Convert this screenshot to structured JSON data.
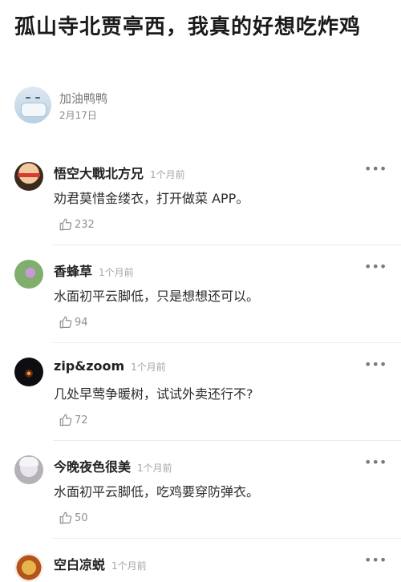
{
  "article": {
    "title": "孤山寺北贾亭西，我真的好想吃炸鸡",
    "author_name": "加油鸭鸭",
    "date": "2月17日"
  },
  "icons": {
    "more": "more-dots-icon",
    "like": "thumbs-up-icon"
  },
  "colors": {
    "text_primary": "#222222",
    "text_muted": "#a6a6a6",
    "divider": "#ececec"
  },
  "comments": [
    {
      "name": "悟空大戰北方兄",
      "time": "1个月前",
      "text": "劝君莫惜金缕衣，打开做菜 APP。",
      "likes": "232"
    },
    {
      "name": "香蜂草",
      "time": "1个月前",
      "text": "水面初平云脚低，只是想想还可以。",
      "likes": "94"
    },
    {
      "name": "zip&zoom",
      "time": "1个月前",
      "text": "几处早莺争暖树，试试外卖还行不?",
      "likes": "72"
    },
    {
      "name": "今晚夜色很美",
      "time": "1个月前",
      "text": "水面初平云脚低，吃鸡要穿防弹衣。",
      "likes": "50"
    },
    {
      "name": "空白凉蜕",
      "time": "1个月前",
      "text": "",
      "likes": ""
    }
  ]
}
